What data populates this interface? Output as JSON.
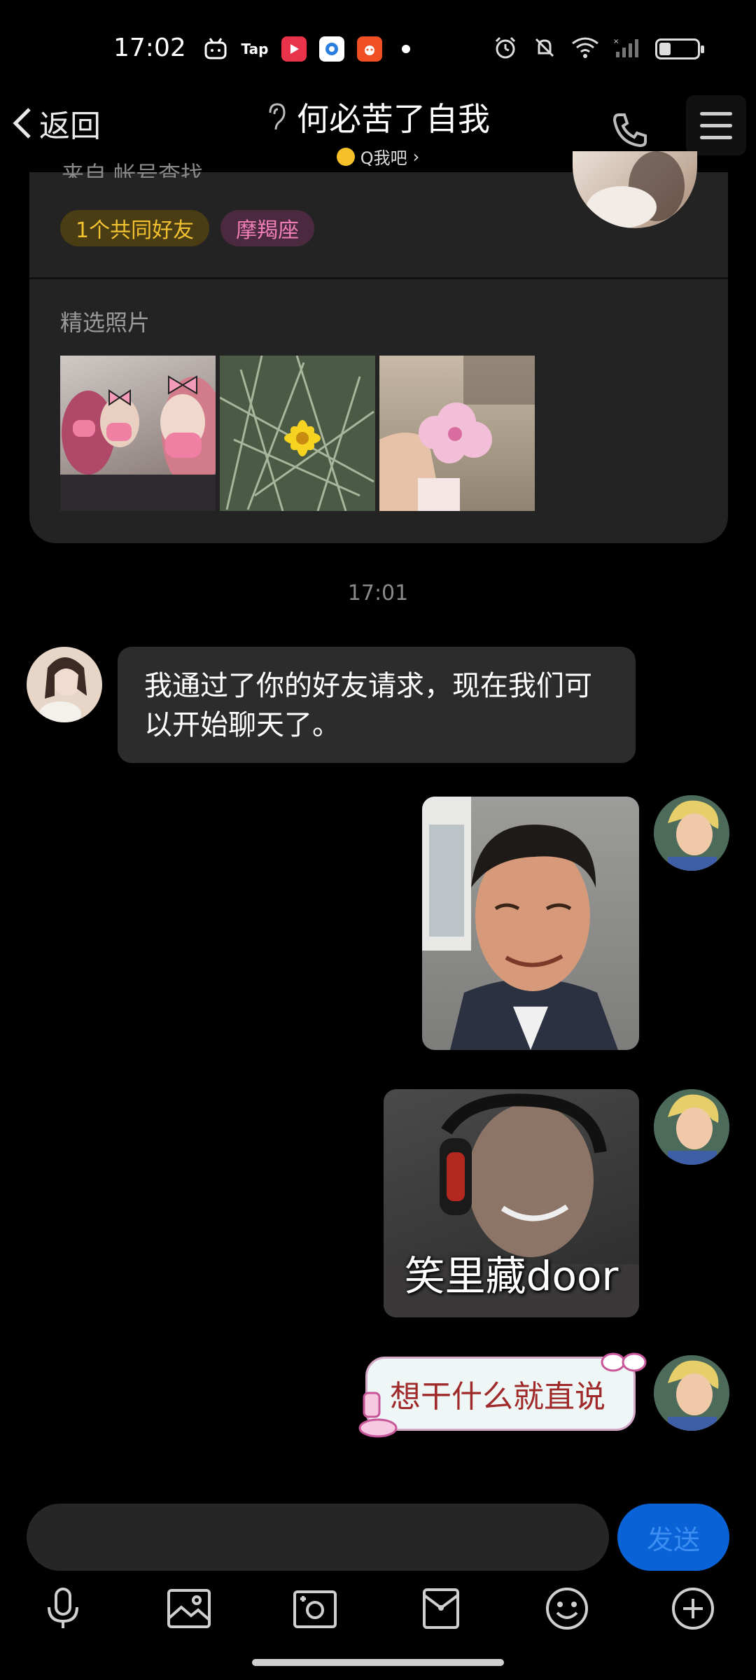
{
  "status_bar": {
    "time": "17:02",
    "apps": [
      "bilibili-icon",
      "Tap",
      "video-app-icon",
      "browser-app-icon",
      "game-app-icon"
    ],
    "tap_label": "Tap",
    "battery_level": 0.3
  },
  "nav": {
    "back_label": "返回",
    "title": "何必苦了自我",
    "subtitle": "Q我吧",
    "subtitle_arrow": "›"
  },
  "profile_card": {
    "source_text": "来自 帐号查找",
    "tags": [
      {
        "label": "1个共同好友",
        "color": "#f2c231"
      },
      {
        "label": "摩羯座",
        "color": "#f07fb7"
      }
    ],
    "photos_label": "精选照片"
  },
  "chat": {
    "timestamp": "17:01",
    "messages": [
      {
        "side": "left",
        "type": "text",
        "text": "我通过了你的好友请求，现在我们可以开始聊天了。"
      },
      {
        "side": "right",
        "type": "sticker",
        "caption": ""
      },
      {
        "side": "right",
        "type": "sticker",
        "caption": "笑里藏door"
      },
      {
        "side": "right",
        "type": "text",
        "text": "想干什么就直说"
      }
    ]
  },
  "input": {
    "placeholder": "",
    "send_label": "发送"
  },
  "toolbar": {
    "items": [
      "microphone-icon",
      "photo-icon",
      "camera-icon",
      "red-packet-icon",
      "emoji-icon",
      "plus-icon"
    ]
  },
  "colors": {
    "accent": "#0a63d6",
    "tag_friends": "#f2c231",
    "tag_zodiac": "#f07fb7",
    "bubble_left": "#2c2c2c"
  }
}
